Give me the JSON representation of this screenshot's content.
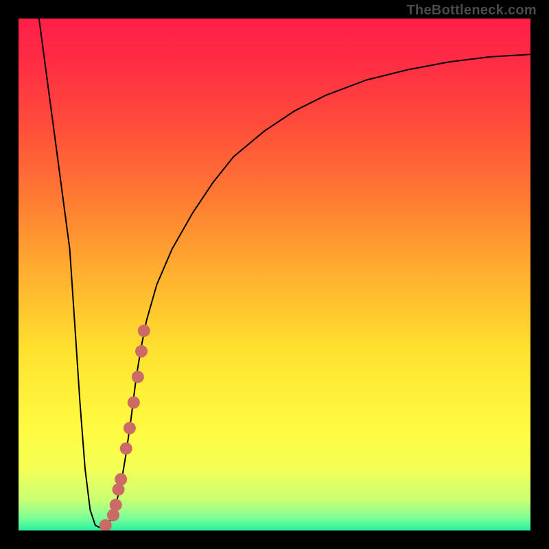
{
  "watermark": "TheBottleneck.com",
  "colors": {
    "frame": "#000000",
    "gradient_stops": [
      {
        "offset": 0.0,
        "color": "#ff1f49"
      },
      {
        "offset": 0.08,
        "color": "#ff2b44"
      },
      {
        "offset": 0.2,
        "color": "#ff4a3b"
      },
      {
        "offset": 0.35,
        "color": "#ff7a33"
      },
      {
        "offset": 0.5,
        "color": "#ffb02f"
      },
      {
        "offset": 0.65,
        "color": "#ffe22f"
      },
      {
        "offset": 0.8,
        "color": "#fffb40"
      },
      {
        "offset": 0.88,
        "color": "#f4ff56"
      },
      {
        "offset": 0.94,
        "color": "#caff74"
      },
      {
        "offset": 0.975,
        "color": "#7eff97"
      },
      {
        "offset": 1.0,
        "color": "#26f2a0"
      }
    ],
    "curve": "#000000",
    "marker": "#cc6a66"
  },
  "chart_data": {
    "type": "line",
    "title": "",
    "xlabel": "",
    "ylabel": "",
    "xlim": [
      0,
      100
    ],
    "ylim": [
      0,
      100
    ],
    "x": [
      4,
      6,
      8,
      10,
      11,
      12,
      13,
      14,
      15,
      16,
      17,
      18,
      19,
      20,
      21,
      22,
      23,
      24,
      25,
      27,
      30,
      34,
      38,
      42,
      48,
      54,
      60,
      68,
      76,
      84,
      92,
      100
    ],
    "values": [
      100,
      85,
      70,
      55,
      40,
      25,
      12,
      4,
      1,
      0.5,
      1,
      2,
      5,
      9,
      15,
      22,
      30,
      36,
      41,
      48,
      55,
      62,
      68,
      73,
      78,
      82,
      85,
      88,
      90,
      91.5,
      92.5,
      93
    ],
    "markers": [
      {
        "x": 17.0,
        "y": 1
      },
      {
        "x": 18.5,
        "y": 3
      },
      {
        "x": 19.0,
        "y": 5
      },
      {
        "x": 19.5,
        "y": 8
      },
      {
        "x": 20.0,
        "y": 10
      },
      {
        "x": 21.0,
        "y": 16
      },
      {
        "x": 21.7,
        "y": 20
      },
      {
        "x": 22.5,
        "y": 25
      },
      {
        "x": 23.3,
        "y": 30
      },
      {
        "x": 24.0,
        "y": 35
      },
      {
        "x": 24.5,
        "y": 39
      }
    ]
  }
}
